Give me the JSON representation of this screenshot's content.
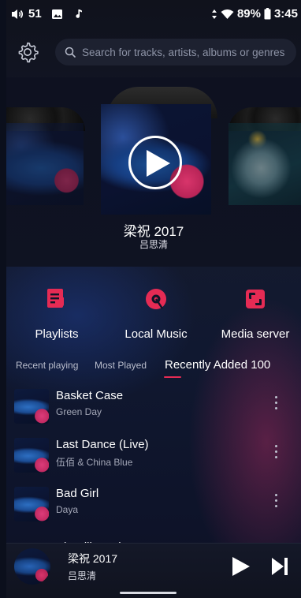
{
  "status_bar": {
    "volume": "51",
    "battery": "89%",
    "time": "3:45"
  },
  "search": {
    "placeholder": "Search for tracks, artists, albums or genres"
  },
  "featured": {
    "title": "梁祝 2017",
    "artist": "吕思清"
  },
  "quick_actions": [
    {
      "label": "Playlists",
      "icon": "playlist-icon"
    },
    {
      "label": "Local Music",
      "icon": "disc-icon"
    },
    {
      "label": "Media server",
      "icon": "media-server-icon"
    }
  ],
  "tabs": [
    {
      "label": "Recent playing",
      "active": false
    },
    {
      "label": "Most Played",
      "active": false
    },
    {
      "label": "Recently Added 100",
      "active": true
    }
  ],
  "tracks": [
    {
      "title": "Basket Case",
      "artist": "Green Day"
    },
    {
      "title": "Last Dance (Live)",
      "artist": "伍佰 & China Blue"
    },
    {
      "title": "Bad Girl",
      "artist": "Daya"
    },
    {
      "title": "Sit Still, Look Pretty",
      "artist": ""
    }
  ],
  "now_playing": {
    "title": "梁祝 2017",
    "artist": "吕思清"
  },
  "colors": {
    "accent": "#e52b54",
    "background": "#0b0f1c"
  }
}
